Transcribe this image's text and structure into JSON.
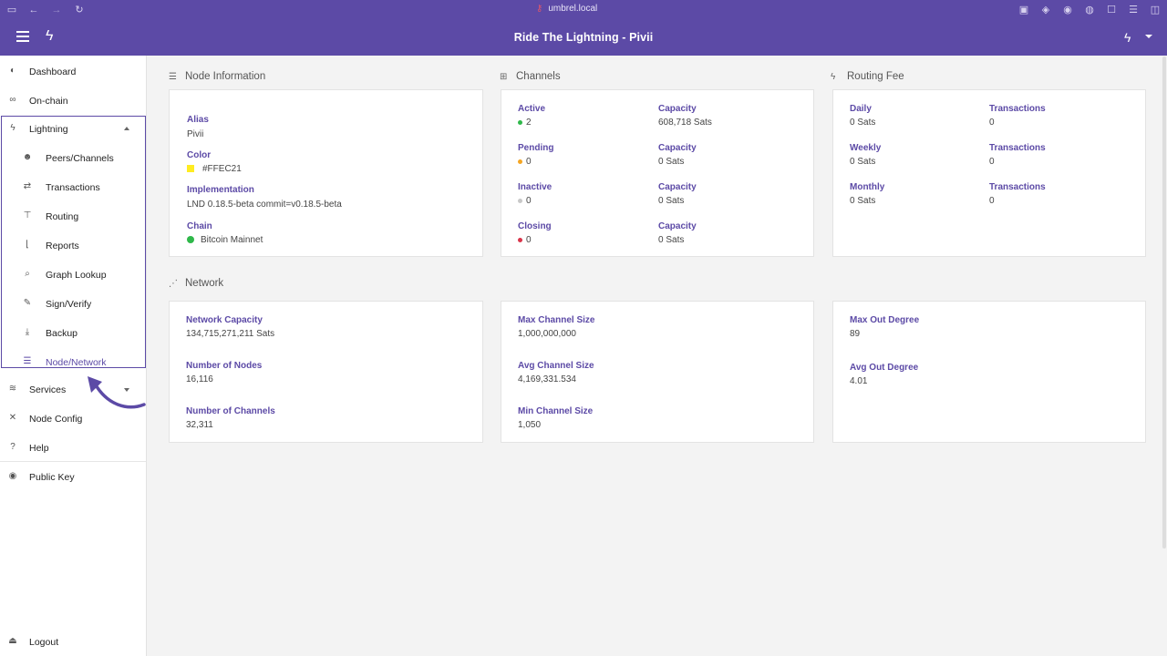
{
  "browser": {
    "url": "umbrel.local"
  },
  "app": {
    "title": "Ride The Lightning - Pivii"
  },
  "sidebar": {
    "items": [
      {
        "label": "Dashboard"
      },
      {
        "label": "On-chain"
      },
      {
        "label": "Lightning"
      },
      {
        "label": "Peers/Channels"
      },
      {
        "label": "Transactions"
      },
      {
        "label": "Routing"
      },
      {
        "label": "Reports"
      },
      {
        "label": "Graph Lookup"
      },
      {
        "label": "Sign/Verify"
      },
      {
        "label": "Backup"
      },
      {
        "label": "Node/Network"
      },
      {
        "label": "Services"
      },
      {
        "label": "Node Config"
      },
      {
        "label": "Help"
      },
      {
        "label": "Public Key"
      },
      {
        "label": "Logout"
      }
    ]
  },
  "node_info": {
    "heading": "Node Information",
    "alias_label": "Alias",
    "alias": "Pivii",
    "color_label": "Color",
    "color": "#FFEC21",
    "impl_label": "Implementation",
    "impl": "LND 0.18.5-beta commit=v0.18.5-beta",
    "chain_label": "Chain",
    "chain": "Bitcoin Mainnet",
    "chain_color": "#2fb84a"
  },
  "channels": {
    "heading": "Channels",
    "rows": [
      {
        "state": "Active",
        "count": "2",
        "dot": "#2fb84a",
        "cap_label": "Capacity",
        "cap": "608,718 Sats"
      },
      {
        "state": "Pending",
        "count": "0",
        "dot": "#f5a623",
        "cap_label": "Capacity",
        "cap": "0 Sats"
      },
      {
        "state": "Inactive",
        "count": "0",
        "dot": "#c8c8c8",
        "cap_label": "Capacity",
        "cap": "0 Sats"
      },
      {
        "state": "Closing",
        "count": "0",
        "dot": "#d9344a",
        "cap_label": "Capacity",
        "cap": "0 Sats"
      }
    ]
  },
  "routing_fee": {
    "heading": "Routing Fee",
    "rows": [
      {
        "period": "Daily",
        "fee": "0 Sats",
        "tx_label": "Transactions",
        "tx": "0"
      },
      {
        "period": "Weekly",
        "fee": "0 Sats",
        "tx_label": "Transactions",
        "tx": "0"
      },
      {
        "period": "Monthly",
        "fee": "0 Sats",
        "tx_label": "Transactions",
        "tx": "0"
      }
    ]
  },
  "network": {
    "heading": "Network",
    "col1": [
      {
        "label": "Network Capacity",
        "value": "134,715,271,211 Sats"
      },
      {
        "label": "Number of Nodes",
        "value": "16,116"
      },
      {
        "label": "Number of Channels",
        "value": "32,311"
      }
    ],
    "col2": [
      {
        "label": "Max Channel Size",
        "value": "1,000,000,000"
      },
      {
        "label": "Avg Channel Size",
        "value": "4,169,331.534"
      },
      {
        "label": "Min Channel Size",
        "value": "1,050"
      }
    ],
    "col3": [
      {
        "label": "Max Out Degree",
        "value": "89"
      },
      {
        "label": "Avg Out Degree",
        "value": "4.01"
      }
    ]
  },
  "colors": {
    "brand": "#5c4aa6"
  }
}
